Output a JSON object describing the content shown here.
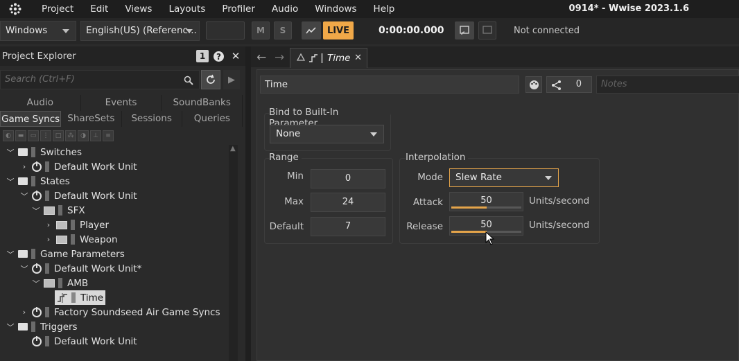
{
  "app": {
    "window_title": "0914* - Wwise 2023.1.6",
    "menu": [
      "Project",
      "Edit",
      "Views",
      "Layouts",
      "Profiler",
      "Audio",
      "Windows",
      "Help"
    ]
  },
  "toolbar": {
    "layout_dropdown": "Windows",
    "language_dropdown": "English(US) (Referenc...",
    "mute_label": "M",
    "solo_label": "S",
    "live_label": "LIVE",
    "timecode": "0:00:00.000",
    "connection_status": "Not connected"
  },
  "project_explorer": {
    "title": "Project Explorer",
    "header_badge": "1",
    "search_placeholder": "Search (Ctrl+F)",
    "tabs_row1": [
      "Audio",
      "Events",
      "SoundBanks"
    ],
    "tabs_row2": [
      "Game Syncs",
      "ShareSets",
      "Sessions",
      "Queries"
    ],
    "active_tab": "Game Syncs",
    "tree": [
      {
        "label": "Switches",
        "type": "folder",
        "depth": 0,
        "expanded": true
      },
      {
        "label": "Default Work Unit",
        "type": "work-unit",
        "depth": 1,
        "expanded": false
      },
      {
        "label": "States",
        "type": "folder",
        "depth": 0,
        "expanded": true
      },
      {
        "label": "Default Work Unit",
        "type": "work-unit",
        "depth": 1,
        "expanded": true
      },
      {
        "label": "SFX",
        "type": "virtual-folder",
        "depth": 2,
        "expanded": true
      },
      {
        "label": "Player",
        "type": "virtual-folder",
        "depth": 3,
        "expanded": false
      },
      {
        "label": "Weapon",
        "type": "virtual-folder",
        "depth": 3,
        "expanded": false
      },
      {
        "label": "Game Parameters",
        "type": "folder",
        "depth": 0,
        "expanded": true
      },
      {
        "label": "Default Work Unit*",
        "type": "work-unit",
        "depth": 1,
        "expanded": true
      },
      {
        "label": "AMB",
        "type": "virtual-folder",
        "depth": 2,
        "expanded": true
      },
      {
        "label": "Time",
        "type": "game-parameter",
        "depth": 3,
        "selected": true
      },
      {
        "label": "Factory Soundseed Air Game Syncs",
        "type": "work-unit",
        "depth": 1,
        "expanded": false
      },
      {
        "label": "Triggers",
        "type": "folder",
        "depth": 0,
        "expanded": true
      },
      {
        "label": "Default Work Unit",
        "type": "work-unit",
        "depth": 1,
        "expanded": null
      }
    ]
  },
  "editor": {
    "tab_label": "Time",
    "object_name": "Time",
    "share_count": "0",
    "notes_placeholder": "Notes",
    "bind": {
      "title": "Bind to Built-In Parameter",
      "value": "None"
    },
    "range": {
      "title": "Range",
      "min_label": "Min",
      "min_value": "0",
      "max_label": "Max",
      "max_value": "24",
      "default_label": "Default",
      "default_value": "7"
    },
    "interpolation": {
      "title": "Interpolation",
      "mode_label": "Mode",
      "mode_value": "Slew Rate",
      "attack_label": "Attack",
      "attack_value": "50",
      "attack_fill": 0.5,
      "release_label": "Release",
      "release_value": "50",
      "release_fill": 0.5,
      "units": "Units/second"
    }
  },
  "colors": {
    "accent": "#e4a44a",
    "live_bg": "#f0a848",
    "background": "#2b2b2b"
  }
}
